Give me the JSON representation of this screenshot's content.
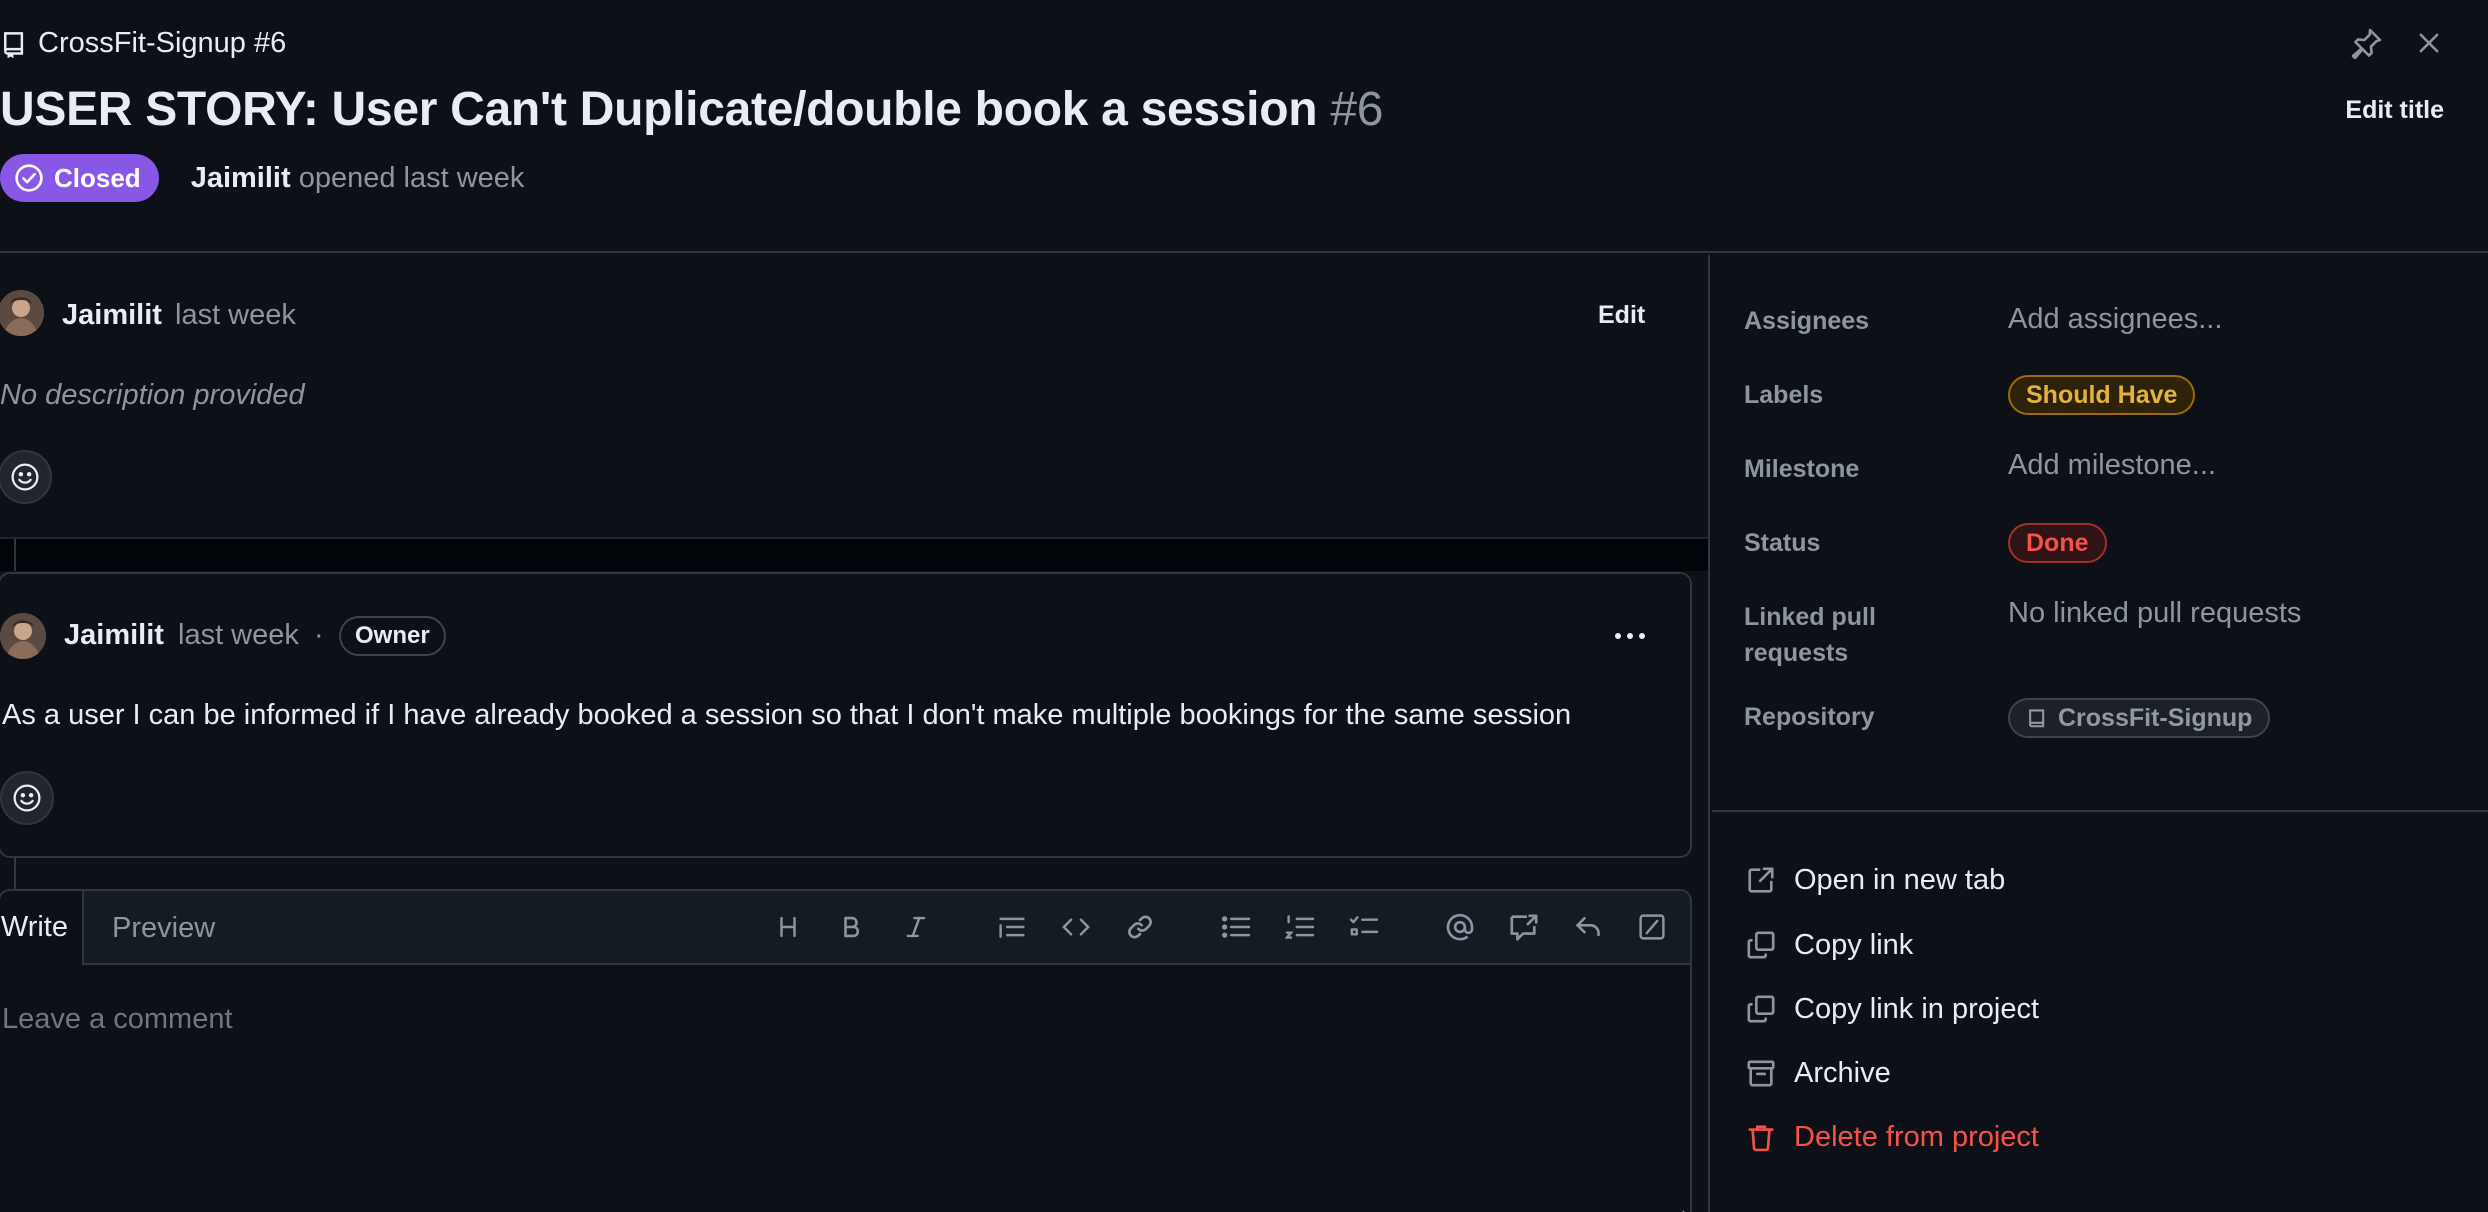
{
  "header": {
    "breadcrumb": "CrossFit-Signup #6",
    "title": "USER STORY: User Can't Duplicate/double book a session",
    "number": "#6",
    "edit_title": "Edit title",
    "state": "Closed",
    "author": "Jaimilit",
    "opened_text": "opened last week"
  },
  "description": {
    "author": "Jaimilit",
    "time": "last week",
    "edit_label": "Edit",
    "text": "No description provided"
  },
  "comment": {
    "author": "Jaimilit",
    "time": "last week",
    "separator": "·",
    "badge": "Owner",
    "body": "As a user I can be informed if I have already booked a session so that I don't make multiple bookings for the same session"
  },
  "editor": {
    "tab_write": "Write",
    "tab_preview": "Preview",
    "placeholder": "Leave a comment",
    "tools": [
      "heading-icon",
      "bold-icon",
      "italic-icon",
      "quote-icon",
      "code-icon",
      "link-icon",
      "bullet-list-icon",
      "numbered-list-icon",
      "task-list-icon",
      "mention-icon",
      "cross-reference-icon",
      "reply-icon",
      "slash-command-icon"
    ]
  },
  "sidebar": {
    "assignees_label": "Assignees",
    "assignees_value": "Add assignees...",
    "labels_label": "Labels",
    "label_value": "Should Have",
    "milestone_label": "Milestone",
    "milestone_value": "Add milestone...",
    "status_label": "Status",
    "status_value": "Done",
    "linked_label_1": "Linked pull",
    "linked_label_2": "requests",
    "linked_value": "No linked pull requests",
    "repository_label": "Repository",
    "repository_value": "CrossFit-Signup",
    "actions": {
      "open_new_tab": "Open in new tab",
      "copy_link": "Copy link",
      "copy_link_project": "Copy link in project",
      "archive": "Archive",
      "delete": "Delete from project"
    }
  },
  "colors": {
    "background": "#0d1117",
    "closed_badge": "#8957e5",
    "label_should_have": "#e3b341",
    "status_done": "#f85149",
    "danger": "#f85149"
  }
}
